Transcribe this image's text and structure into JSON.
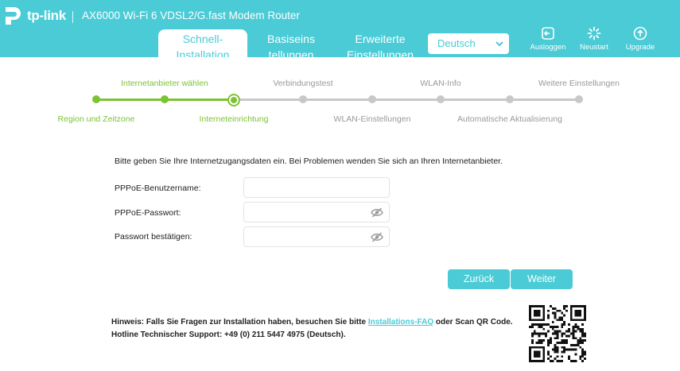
{
  "header": {
    "brand": "tp-link",
    "model": "AX6000 Wi-Fi 6 VDSL2/G.fast Modem Router",
    "tabs": [
      {
        "line1": "Schnell-",
        "line2": "Installation",
        "active": true
      },
      {
        "line1": "Basiseins",
        "line2": "tellungen",
        "active": false
      },
      {
        "line1": "Erweiterte",
        "line2": "Einstellungen",
        "active": false
      }
    ],
    "language": "Deutsch",
    "buttons": {
      "logout": "Ausloggen",
      "reboot": "Neustart",
      "upgrade": "Upgrade"
    },
    "icons": {
      "logout": "logout-icon",
      "reboot": "reboot-icon",
      "upgrade": "upgrade-icon"
    }
  },
  "steps": [
    {
      "label": "Region und Zeitzone",
      "status": "done"
    },
    {
      "label": "Internetanbieter wählen",
      "status": "done"
    },
    {
      "label": "Interneteinrichtung",
      "status": "current"
    },
    {
      "label": "Verbindungstest",
      "status": "todo"
    },
    {
      "label": "WLAN-Einstellungen",
      "status": "todo"
    },
    {
      "label": "WLAN-Info",
      "status": "todo"
    },
    {
      "label": "Automatische Aktualisierung",
      "status": "todo"
    },
    {
      "label": "Weitere Einstellungen",
      "status": "todo"
    }
  ],
  "form": {
    "intro": "Bitte geben Sie Ihre Internetzugangsdaten ein. Bei Problemen wenden Sie sich an Ihren Internetanbieter.",
    "username_label": "PPPoE-Benutzername:",
    "username_value": "",
    "password_label": "PPPoE-Passwort:",
    "password_value": "",
    "confirm_label": "Passwort bestätigen:",
    "confirm_value": ""
  },
  "actions": {
    "back": "Zurück",
    "next": "Weiter"
  },
  "hint": {
    "prefix": "Hinweis: Falls Sie Fragen zur Installation haben, besuchen Sie bitte",
    "link": "Installations-FAQ",
    "suffix": "oder Scan QR Code.",
    "hotline": "Hotline Technischer Support: +49 (0) 211 5447 4975 (Deutsch)."
  },
  "colors": {
    "accent": "#4acbd6",
    "progress": "#7cc334",
    "pending": "#c8c8c8"
  }
}
